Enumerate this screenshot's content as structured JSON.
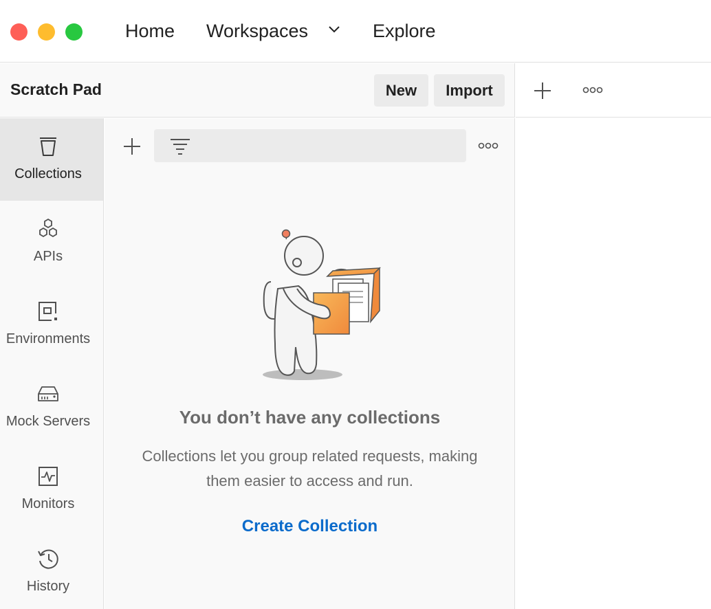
{
  "titlebar": {
    "nav": {
      "home": "Home",
      "workspaces": "Workspaces",
      "explore": "Explore"
    },
    "icons": {
      "workspaces_chevron": "chevron-down-icon"
    },
    "traffic_colors": {
      "close": "#fe5f57",
      "minimize": "#febc2e",
      "maximize": "#28c840"
    }
  },
  "workspace": {
    "title": "Scratch Pad",
    "new_label": "New",
    "import_label": "Import"
  },
  "tabs": {
    "icons": [
      "plus-icon",
      "more-icon"
    ]
  },
  "sidebar": {
    "items": [
      {
        "label": "Collections",
        "icon": "collections-icon",
        "active": true
      },
      {
        "label": "APIs",
        "icon": "apis-icon",
        "active": false
      },
      {
        "label": "Environments",
        "icon": "environments-icon",
        "active": false
      },
      {
        "label": "Mock Servers",
        "icon": "mock-servers-icon",
        "active": false
      },
      {
        "label": "Monitors",
        "icon": "monitors-icon",
        "active": false
      },
      {
        "label": "History",
        "icon": "history-icon",
        "active": false
      }
    ]
  },
  "collections_panel": {
    "search_placeholder": "",
    "empty_state": {
      "title": "You don’t have any collections",
      "description": "Collections let you group related requests, making them easier to access and run.",
      "action": "Create Collection"
    }
  },
  "colors": {
    "accent_link": "#0b6bcb",
    "illustration_orange": "#f6a04d"
  }
}
